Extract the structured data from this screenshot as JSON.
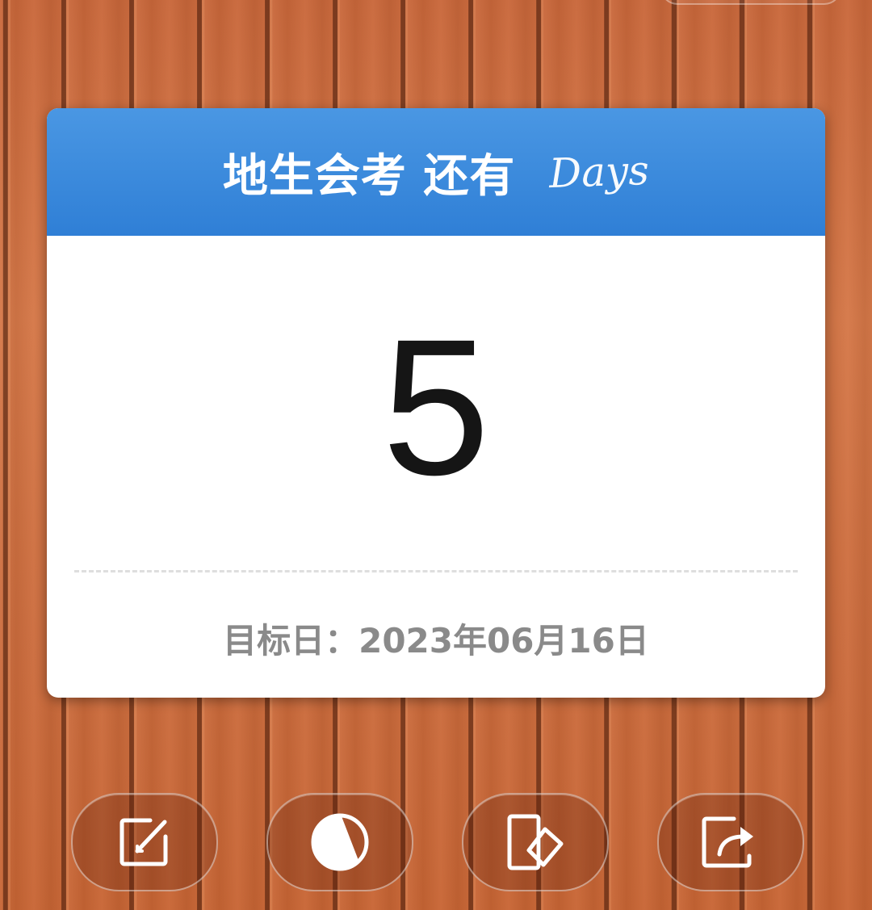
{
  "card": {
    "title": "地生会考 还有",
    "days_label": "Days",
    "count": "5",
    "target_date": "目标日：2023年06月16日"
  },
  "colors": {
    "header_blue": "#3584dc",
    "card_bg": "#ffffff",
    "count_text": "#151515",
    "date_text": "#8a8a8a",
    "wood": "#cf7041"
  },
  "toolbar": [
    {
      "name": "edit-button",
      "icon": "edit-icon"
    },
    {
      "name": "theme-button",
      "icon": "contrast-icon"
    },
    {
      "name": "card-style-button",
      "icon": "cards-icon"
    },
    {
      "name": "share-button",
      "icon": "share-icon"
    }
  ]
}
